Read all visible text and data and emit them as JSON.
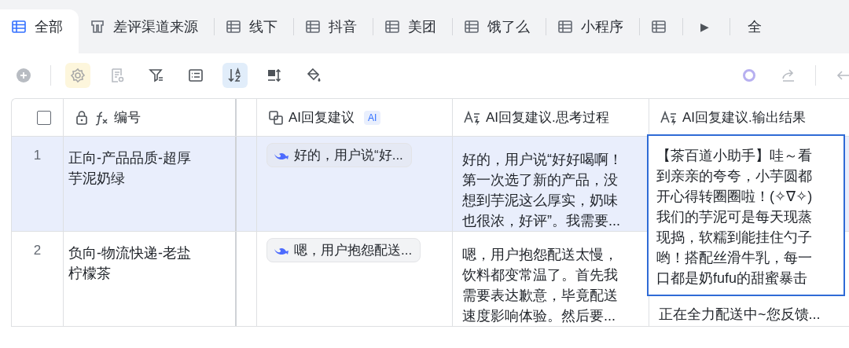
{
  "tabs": [
    {
      "label": "全部",
      "kind": "grid",
      "selected": true
    },
    {
      "label": "差评渠道来源",
      "kind": "kanban",
      "selected": false
    },
    {
      "label": "线下",
      "kind": "grid",
      "selected": false
    },
    {
      "label": "抖音",
      "kind": "grid",
      "selected": false
    },
    {
      "label": "美团",
      "kind": "grid",
      "selected": false
    },
    {
      "label": "饿了么",
      "kind": "grid",
      "selected": false
    },
    {
      "label": "小程序",
      "kind": "grid",
      "selected": false
    },
    {
      "kind": "grid",
      "selected": false
    }
  ],
  "tab_more": "▶",
  "tab_cut": "全",
  "toolbar": {
    "left": [
      {
        "kind": "add",
        "disabled": true,
        "active": false
      },
      {
        "kind": "divider"
      },
      {
        "kind": "gear",
        "disabled": true,
        "active": true
      },
      {
        "kind": "form",
        "disabled": true,
        "active": false
      },
      {
        "kind": "filter",
        "disabled": false,
        "active": false
      },
      {
        "kind": "list",
        "disabled": false,
        "active": false
      },
      {
        "kind": "sort",
        "disabled": false,
        "active": true
      },
      {
        "kind": "rowheight",
        "disabled": false,
        "active": false
      },
      {
        "kind": "fill",
        "disabled": false,
        "active": false
      }
    ],
    "right": [
      {
        "kind": "ring",
        "active": false
      },
      {
        "kind": "share",
        "disabled": true,
        "active": false
      },
      {
        "kind": "divider"
      },
      {
        "kind": "back",
        "disabled": true,
        "active": false
      }
    ]
  },
  "table": {
    "select_all": {
      "checked": false
    },
    "columns": [
      {
        "label": "编号",
        "kind": "formula",
        "locked": true
      },
      {
        "label": "AI回复建议",
        "kind": "ai",
        "badge": "AI"
      },
      {
        "label": "AI回复建议.思考过程",
        "kind": "ai-text"
      },
      {
        "label": "AI回复建议.输出结果",
        "kind": "ai-text"
      }
    ],
    "rows": [
      {
        "number": "1",
        "title": "正向-产品品质-超厚芋泥奶绿",
        "suggestion": "好的，用户说“好...",
        "thinking": "好的，用户说“好好喝啊！第一次选了新的产品，没想到芋泥这么厚实，奶味也很浓，好评”。我需要...",
        "output": "【茶百道小助手】哇～看到亲亲的夸夸，小芋圆都开心得转圈圈啦！(✧∇✧)我们的芋泥可是每天现蒸现捣，软糯到能挂住勺子哟！搭配丝滑牛乳，每一口都是奶fufu的甜蜜暴击",
        "expanded": true,
        "selected": true
      },
      {
        "number": "2",
        "title": "负向-物流快递-老盐柠檬茶",
        "suggestion": "嗯，用户抱怨配送...",
        "thinking": "嗯，用户抱怨配送太慢，饮料都变常温了。首先我需要表达歉意，毕竟配送速度影响体验。然后要...",
        "output": "正在全力配送中~您反馈...",
        "expanded": false,
        "selected": false
      }
    ]
  }
}
